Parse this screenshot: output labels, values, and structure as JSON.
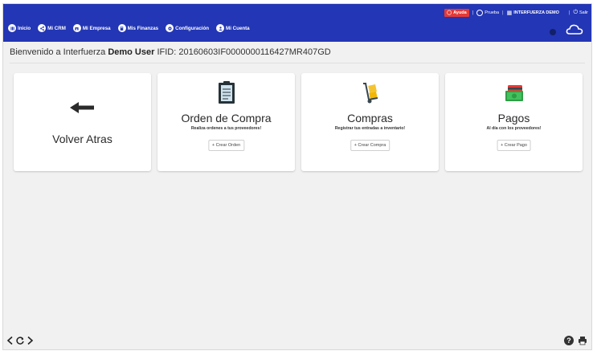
{
  "topbar": {
    "help_label": "Ayuda",
    "user_label": "Prueba",
    "company_label": "INTERFUERZA DEMO",
    "logout_label": "Salir",
    "separator": "|"
  },
  "menu": [
    {
      "label": "Inicio",
      "icon": "grid-icon"
    },
    {
      "label": "Mi CRM",
      "icon": "share-icon"
    },
    {
      "label": "Mi Empresa",
      "icon": "store-icon"
    },
    {
      "label": "Mis Finanzas",
      "icon": "calculator-icon"
    },
    {
      "label": "Configuración",
      "icon": "gear-icon"
    },
    {
      "label": "Mi Cuenta",
      "icon": "user-icon"
    }
  ],
  "welcome": {
    "prefix": "Bienvenido a Interfuerza",
    "user": "Demo User",
    "ifid": "IFID: 20160603IF0000000116427MR407GD"
  },
  "cards": {
    "back": {
      "title": "Volver Atras"
    },
    "orden": {
      "title": "Orden de Compra",
      "subtitle": "Realiza ordenes a tus proveedores!",
      "button": "+ Crear Orden"
    },
    "compras": {
      "title": "Compras",
      "subtitle": "Registrar tus entradas a inventario!",
      "button": "+ Crear Compra"
    },
    "pagos": {
      "title": "Pagos",
      "subtitle": "Al día con los proveedores!",
      "button": "+ Crear Pago"
    }
  },
  "colors": {
    "header": "#2336b5",
    "help": "#e53935",
    "accent_green": "#2e9e44"
  }
}
